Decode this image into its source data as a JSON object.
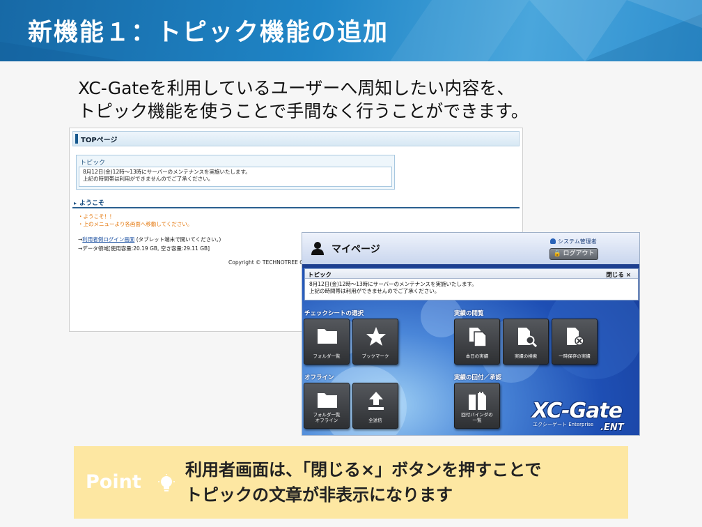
{
  "header": {
    "title": "新機能１：トピック機能の追加",
    "color": "#1f85c6"
  },
  "intro": {
    "line1": "XC-Gateを利用しているユーザーへ周知したい内容を、",
    "line2": "トピック機能を使うことで手間なく行うことができます。"
  },
  "shot1": {
    "page_title": "TOPページ",
    "topic_title": "トピック",
    "topic_line1": "8月12日(金)12時～13時にサーバーのメンテナンスを実施いたします。",
    "topic_line2": "上記の時間帯は利用ができませんのでご了承ください。",
    "welcome": "ようこそ",
    "msg1": "・ようこそ！！",
    "msg2": "・上のメニューより各画面へ移動してください。",
    "link_prefix": "→",
    "link_text": "利用者側ログイン画面",
    "link_note": "(タブレット端末で開いてください。)",
    "data_info": "→データ領域[使用容量:20.19 GB, 空き容量:29.11 GB]",
    "copyright": "Copyright © TECHNOTREE CO."
  },
  "shot2": {
    "title": "マイページ",
    "admin": "システム管理者",
    "logout": "ログアウト",
    "topic_title": "トピック",
    "close": "閉じる ×",
    "topic_line1": "8月12日(金)12時～13時にサーバーのメンテナンスを実施いたします。",
    "topic_line2": "上記の時間帯は利用ができませんのでご了承ください。",
    "sections": {
      "checksheet": "チェックシートの選択",
      "results": "実績の閲覧",
      "offline": "オフライン",
      "approval": "実績の回付／承認"
    },
    "tiles": {
      "folder_list": "フォルダ一覧",
      "bookmark": "ブックマーク",
      "today_results": "本日の実績",
      "search_results": "実績の検索",
      "temp_results": "一時保存の実績",
      "folder_offline_1": "フォルダ一覧",
      "folder_offline_2": "オフライン",
      "send_all": "全送信",
      "binder_1": "回付バインダの",
      "binder_2": "一覧"
    },
    "logo_main": "XC-Gate",
    "logo_sub": "エクシーゲート Enterprise",
    "logo_ent": ".ENT"
  },
  "point": {
    "label": "Point",
    "line1": "利用者画面は、「閉じる×」ボタンを押すことで",
    "line2": "トピックの文章が非表示になります",
    "bg_color": "#fde7a2"
  }
}
